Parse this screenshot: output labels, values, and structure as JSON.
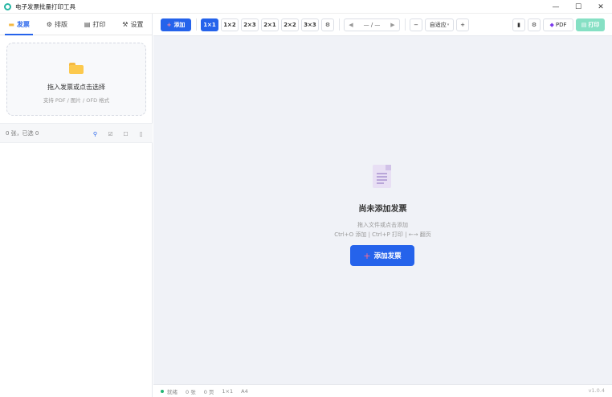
{
  "window": {
    "title": "电子发票批量打印工具",
    "minimize": "—",
    "maximize": "☐",
    "close": "✕"
  },
  "tabs": [
    {
      "icon": "folder-icon",
      "label": "发票"
    },
    {
      "icon": "gear-icon",
      "label": "排版"
    },
    {
      "icon": "printer-icon",
      "label": "打印"
    },
    {
      "icon": "wrench-icon",
      "label": "设置"
    }
  ],
  "dropzone": {
    "title": "拖入发票或点击选择",
    "subtitle": "支持 PDF / 图片 / OFD 格式"
  },
  "list": {
    "count_text": "0 张，已选 0"
  },
  "toolbar": {
    "add_label": "添加",
    "layouts": [
      "1×1",
      "1×2",
      "2×3",
      "2×1",
      "2×2",
      "3×3"
    ],
    "active_layout": "1×1",
    "page_text": "— / —",
    "zoom_minus": "−",
    "zoom_value": "自适应",
    "zoom_plus": "+",
    "pdf_label": "PDF",
    "print_label": "打印"
  },
  "empty": {
    "title": "尚未添加发票",
    "sub1": "拖入文件或点击添加",
    "sub2": "Ctrl+O 添加 | Ctrl+P 打印 | ←→ 翻页",
    "button_label": "添加发票"
  },
  "status": {
    "state": "就绪",
    "count": "0 张",
    "pages": "0 页",
    "layout": "1×1",
    "paper": "A4",
    "version": "v1.0.4"
  },
  "colors": {
    "accent": "#2563eb",
    "print_button": "#86e0c4",
    "status_ok": "#22b573"
  }
}
